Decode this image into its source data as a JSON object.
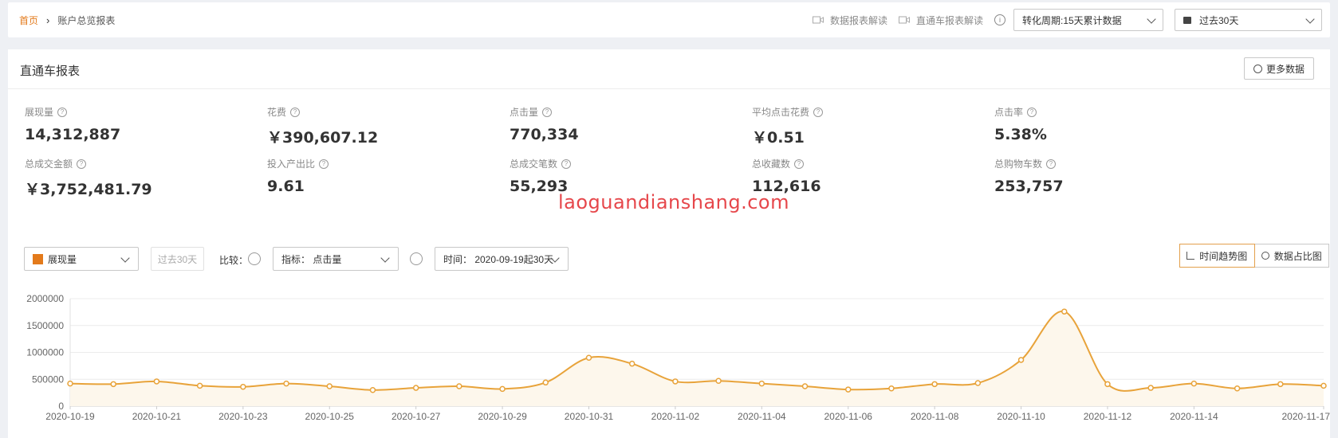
{
  "breadcrumb": {
    "home": "首页",
    "current": "账户总览报表"
  },
  "toolbar": {
    "link_data_report": "数据报表解读",
    "link_ztc_report": "直通车报表解读",
    "info_icon": "i",
    "conversion_cycle": "转化周期:15天累计数据",
    "date_range": "过去30天"
  },
  "panel": {
    "title": "直通车报表",
    "more_button": "更多数据"
  },
  "metrics": [
    {
      "label": "展现量",
      "value": "14,312,887"
    },
    {
      "label": "花费",
      "value": "￥390,607.12"
    },
    {
      "label": "点击量",
      "value": "770,334"
    },
    {
      "label": "平均点击花费",
      "value": "￥0.51"
    },
    {
      "label": "点击率",
      "value": "5.38%"
    },
    {
      "label": "总成交金额",
      "value": "￥3,752,481.79"
    },
    {
      "label": "投入产出比",
      "value": "9.61"
    },
    {
      "label": "总成交笔数",
      "value": "55,293"
    },
    {
      "label": "总收藏数",
      "value": "112,616"
    },
    {
      "label": "总购物车数",
      "value": "253,757"
    }
  ],
  "help_icon": "?",
  "watermark": "laoguandianshang.com",
  "controls": {
    "metric_select": "展现量",
    "past_button": "过去30天",
    "compare_label": "比较：",
    "indicator_select": "指标：  点击量",
    "time_select": "时间：  2020-09-19起30天",
    "view_trend": "时间趋势图",
    "view_share": "数据占比图"
  },
  "colors": {
    "accent": "#e37a1b",
    "line": "#e8a33a",
    "area": "#fdf7ec"
  },
  "chart_data": {
    "type": "area",
    "series": [
      {
        "values": [
          420000,
          410000,
          460000,
          380000,
          360000,
          420000,
          370000,
          300000,
          340000,
          370000,
          320000,
          440000,
          900000,
          790000,
          460000,
          470000,
          420000,
          370000,
          310000,
          330000,
          410000,
          430000,
          860000,
          1760000,
          410000,
          340000,
          420000,
          330000,
          410000,
          380000
        ]
      }
    ],
    "x": [
      "2020-10-19",
      "2020-10-20",
      "2020-10-21",
      "2020-10-22",
      "2020-10-23",
      "2020-10-24",
      "2020-10-25",
      "2020-10-26",
      "2020-10-27",
      "2020-10-28",
      "2020-10-29",
      "2020-10-30",
      "2020-10-31",
      "2020-11-01",
      "2020-11-02",
      "2020-11-03",
      "2020-11-04",
      "2020-11-05",
      "2020-11-06",
      "2020-11-07",
      "2020-11-08",
      "2020-11-09",
      "2020-11-10",
      "2020-11-11",
      "2020-11-12",
      "2020-11-13",
      "2020-11-14",
      "2020-11-15",
      "2020-11-16",
      "2020-11-17"
    ],
    "x_tick_labels": [
      "2020-10-19",
      "2020-10-21",
      "2020-10-23",
      "2020-10-25",
      "2020-10-27",
      "2020-10-29",
      "2020-10-31",
      "2020-11-02",
      "2020-11-04",
      "2020-11-06",
      "2020-11-08",
      "2020-11-10",
      "2020-11-12",
      "2020-11-14",
      "2020-11-17"
    ],
    "y_ticks": [
      "0",
      "500000",
      "1000000",
      "1500000",
      "2000000"
    ],
    "ylim": [
      0,
      2000000
    ],
    "grid": true,
    "legend": "none"
  }
}
